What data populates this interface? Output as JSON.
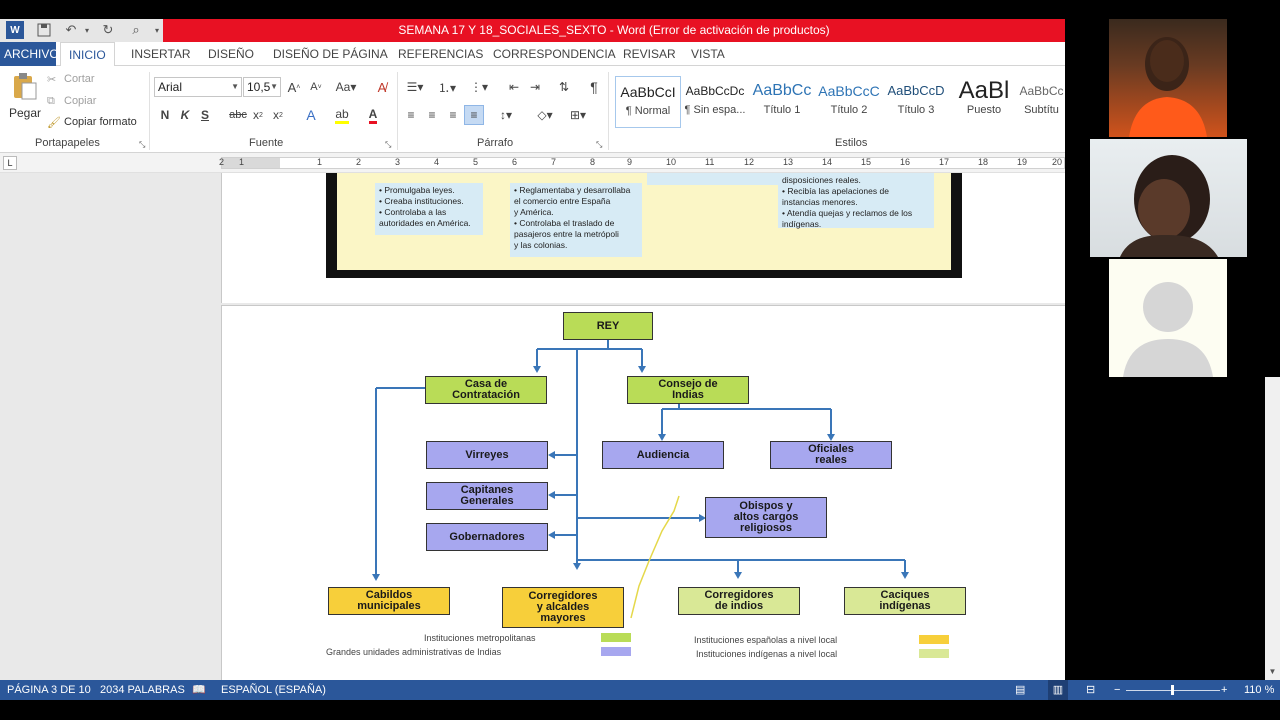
{
  "window": {
    "title": "SEMANA 17 Y 18_SOCIALES_SEXTO -  Word (Error de activación de productos)"
  },
  "ribbon_tabs": [
    "ARCHIVO",
    "INICIO",
    "INSERTAR",
    "DISEÑO",
    "DISEÑO DE PÁGINA",
    "REFERENCIAS",
    "CORRESPONDENCIA",
    "REVISAR",
    "VISTA"
  ],
  "clipboard": {
    "paste": "Pegar",
    "cut": "Cortar",
    "copy": "Copiar",
    "format_painter": "Copiar formato",
    "label": "Portapapeles"
  },
  "font": {
    "family": "Arial",
    "size": "10,5",
    "label": "Fuente",
    "bold": "N",
    "italic": "K",
    "underline": "S",
    "strike": "abc"
  },
  "paragraph": {
    "label": "Párrafo"
  },
  "styles": {
    "label": "Estilos",
    "items": [
      {
        "preview": "AaBbCcI",
        "name": "¶ Normal"
      },
      {
        "preview": "AaBbCcDc",
        "name": "¶ Sin espa..."
      },
      {
        "preview": "AaBbCc",
        "name": "Título 1"
      },
      {
        "preview": "AaBbCcC",
        "name": "Título 2"
      },
      {
        "preview": "AaBbCcD",
        "name": "Título 3"
      },
      {
        "preview": "AaBl",
        "name": "Puesto"
      },
      {
        "preview": "AaBbCc",
        "name": "Subtítu"
      }
    ]
  },
  "ruler": {
    "numbers": [
      "1",
      "2",
      "1",
      "2",
      "3",
      "4",
      "5",
      "6",
      "7",
      "8",
      "9",
      "10",
      "11",
      "12",
      "13",
      "14",
      "15",
      "16",
      "17",
      "18",
      "19",
      "20"
    ]
  },
  "image1": {
    "col1": [
      "• Promulgaba leyes.",
      "• Creaba instituciones.",
      "• Controlaba a las",
      "  autoridades en América."
    ],
    "col2": [
      "• Reglamentaba y  desarrollaba",
      "  el comercio entre España",
      "  y América.",
      "• Controlaba el traslado de",
      "  pasajeros entre la metrópoli",
      "  y las colonias."
    ],
    "col3": [
      "  disposiciones reales.",
      "• Recibía las apelaciones de",
      "  instancias menores.",
      "• Atendía quejas y reclamos de los",
      "  indígenas."
    ]
  },
  "org_chart": {
    "rey": "REY",
    "casa": "Casa de\nContratación",
    "consejo": "Consejo de\nIndias",
    "virreyes": "Virreyes",
    "capitanes": "Capitanes\nGenerales",
    "gobernadores": "Gobernadores",
    "audiencia": "Audiencia",
    "oficiales": "Oficiales\nreales",
    "obispos": "Obispos y\naltos cargos\nreligiosos",
    "cabildos": "Cabildos\nmunicipales",
    "corregidores_alcaldes": "Corregidores\ny alcaldes\nmayores",
    "corregidores_indios": "Corregidores\nde indios",
    "caciques": "Caciques\nindígenas",
    "legend": {
      "metropolitanas": "Instituciones metropolitanas",
      "grandes": "Grandes unidades administrativas de Indias",
      "espanolas_local": "Instituciones españolas a nivel local",
      "indigenas_local": "Instituciones indígenas a nivel local"
    },
    "colors": {
      "green": "#b9dc57",
      "purple": "#a7a7ef",
      "yellow": "#f7cf3a",
      "light_green": "#d9e896"
    }
  },
  "status": {
    "page": "PÁGINA 3 DE 10",
    "words": "2034 PALABRAS",
    "language": "ESPAÑOL (ESPAÑA)",
    "zoom": "110 %"
  },
  "accent": "#2b579a"
}
